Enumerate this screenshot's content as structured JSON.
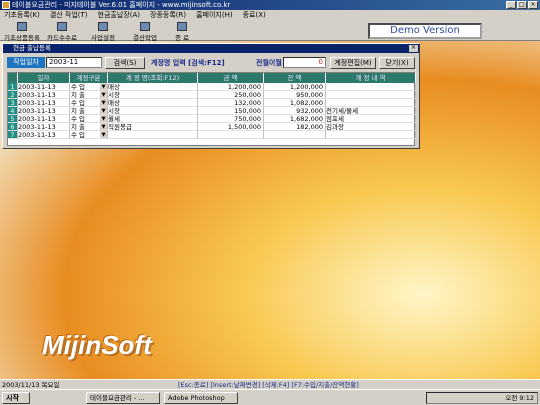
{
  "window": {
    "title": "테이블요금관리 - 미지테이블 Ver.6.01 홈페이지 - www.mijinsoft.co.kr"
  },
  "menu": [
    "기초등록(K)",
    "결산 작업(T)",
    "현금출납장(A)",
    "장종등록(R)",
    "홈페이지(H)",
    "종료(X)"
  ],
  "toolbar": [
    {
      "label": "기초상품등록"
    },
    {
      "label": "카드수수료"
    },
    {
      "label": "사업설정"
    },
    {
      "label": "결산작업"
    },
    {
      "label": "종 료"
    }
  ],
  "demo_label": "Demo Version",
  "form": {
    "title": "현금 출납등록",
    "work_date_label": "작업일자",
    "month_value": "2003-11",
    "search_button": "검색(S)",
    "hint": "계정명 입력 [검색:F12]",
    "carry_label": "전월이월",
    "carry_value": "0",
    "edit_account_button": "계정편집(M)",
    "close_button": "닫기(X)"
  },
  "grid": {
    "headers": [
      "",
      "일자",
      "계정구분",
      "계 정 명(조회:F12)",
      "금 액",
      "잔 액",
      "계 정 내 역"
    ],
    "rows": [
      {
        "n": "1",
        "date": "2003-11-13",
        "type": "수 입",
        "account": "매상",
        "amount": "1,200,000",
        "balance": "1,200,000",
        "note": ""
      },
      {
        "n": "2",
        "date": "2003-11-13",
        "type": "지 출",
        "account": "시장",
        "amount": "250,000",
        "balance": "950,000",
        "note": ""
      },
      {
        "n": "3",
        "date": "2003-11-13",
        "type": "수 입",
        "account": "매상",
        "amount": "132,000",
        "balance": "1,082,000",
        "note": ""
      },
      {
        "n": "4",
        "date": "2003-11-13",
        "type": "지 출",
        "account": "시장",
        "amount": "150,000",
        "balance": "932,000",
        "note": "전기세/물세"
      },
      {
        "n": "5",
        "date": "2003-11-13",
        "type": "수 입",
        "account": "월세",
        "amount": "750,000",
        "balance": "1,682,000",
        "note": "점포세"
      },
      {
        "n": "6",
        "date": "2003-11-13",
        "type": "지 출",
        "account": "직원봉급",
        "amount": "1,500,000",
        "balance": "182,000",
        "note": "김과장"
      },
      {
        "n": "7",
        "date": "2003-11-13",
        "type": "수 입",
        "account": "",
        "amount": "",
        "balance": "",
        "note": ""
      }
    ]
  },
  "logo_text": "MijinSoft",
  "statusbar": {
    "left": "2003/11/13 목요일",
    "shortcuts": "[Esc:종료]  [Insert:날짜변경]  [삭제:F4]  [F7:수입/지출/잔액현황]"
  },
  "taskbar": {
    "start": "시작",
    "tasks": [
      "테이블요금관리 - ...",
      "Adobe Photoshop"
    ],
    "clock": "오전 9:12"
  }
}
